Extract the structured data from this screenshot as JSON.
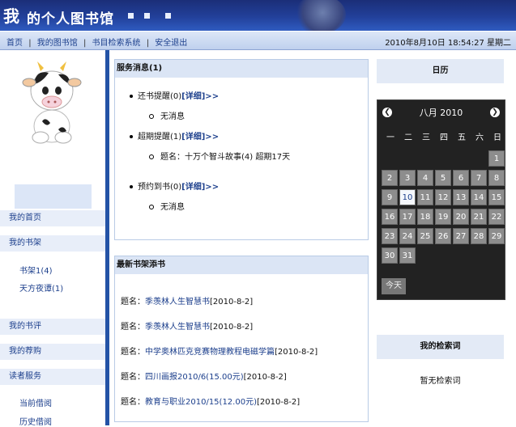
{
  "header": {
    "title_char": "我",
    "title": "的个人图书馆"
  },
  "nav": {
    "links": [
      "首页",
      "我的图书馆",
      "书目检索系统",
      "安全退出"
    ],
    "datetime": "2010年8月10日 18:54:27 星期二"
  },
  "sidebar": {
    "items": [
      "我的首页",
      "我的书架",
      "我的书评",
      "我的荐购",
      "读者服务"
    ],
    "shelf_sub": [
      "书架1(4)",
      "天方夜谭(1)"
    ],
    "service_sub": [
      "当前借阅",
      "历史借阅"
    ]
  },
  "messages": {
    "title": "服务消息(1)",
    "detail_label": "[详细]>>",
    "groups": [
      {
        "label": "还书提醒(0)",
        "sub": "无消息"
      },
      {
        "label": "超期提醒(1)",
        "sub": "题名：十万个智斗故事(4) 超期17天"
      },
      {
        "label": "预约到书(0)",
        "sub": "无消息"
      }
    ]
  },
  "new_books": {
    "title": "最新书架添书",
    "prefix": "题名：",
    "items": [
      {
        "name": "季羡林人生智慧书",
        "date": "[2010-8-2]"
      },
      {
        "name": "季羡林人生智慧书",
        "date": "[2010-8-2]"
      },
      {
        "name": "中学奥林匹克竞赛物理教程电磁学篇",
        "date": "[2010-8-2]"
      },
      {
        "name": "四川画报2010/6(15.00元)",
        "date": "[2010-8-2]"
      },
      {
        "name": "教育与职业2010/15(12.00元)",
        "date": "[2010-8-2]"
      }
    ]
  },
  "calendar": {
    "title": "日历",
    "month": "八月 2010",
    "weekdays": [
      "一",
      "二",
      "三",
      "四",
      "五",
      "六",
      "日"
    ],
    "first_weekday_index": 6,
    "days_in_month": 31,
    "today": 10,
    "today_label": "今天",
    "prev_icon": "chevron-left-icon",
    "next_icon": "chevron-right-icon"
  },
  "search": {
    "title": "我的检索词",
    "empty": "暂无检索词"
  },
  "colors": {
    "accent": "#2453a6",
    "link": "#1c3f8c",
    "panel_header": "#dbe5f5"
  }
}
